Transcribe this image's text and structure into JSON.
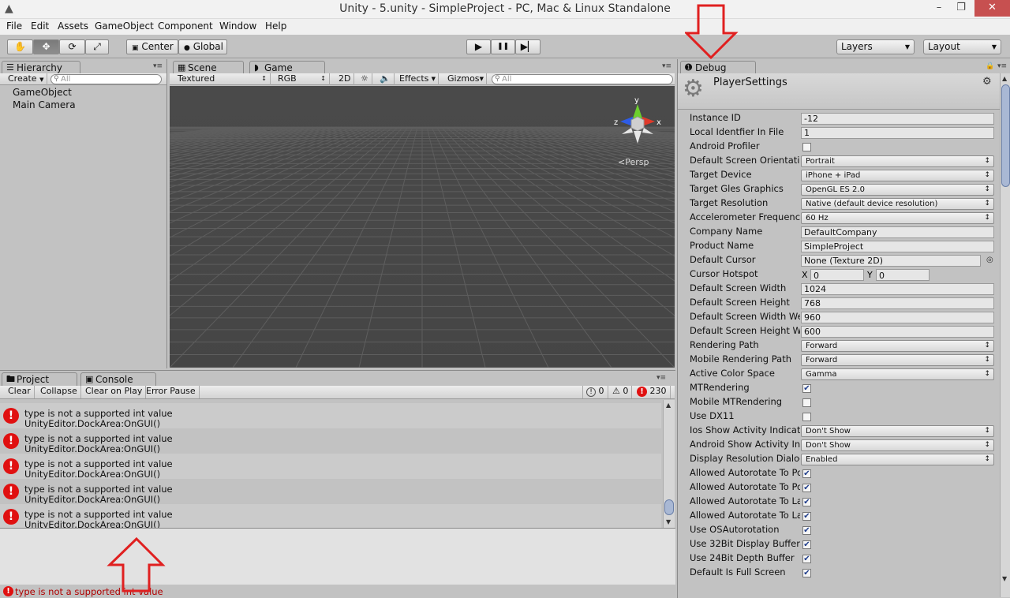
{
  "window": {
    "title": "Unity - 5.unity - SimpleProject - PC, Mac & Linux Standalone",
    "minimize": "–",
    "maximize": "❐",
    "close": "✕"
  },
  "menu": [
    "File",
    "Edit",
    "Assets",
    "GameObject",
    "Component",
    "Window",
    "Help"
  ],
  "toolbar": {
    "tools": [
      "hand-icon",
      "move-icon",
      "rotate-icon",
      "scale-icon"
    ],
    "center": "Center",
    "global": "Global",
    "play": "▶",
    "pause": "❚❚",
    "step": "▶▏",
    "layers": "Layers",
    "layout": "Layout"
  },
  "hierarchy": {
    "tab": "Hierarchy",
    "create": "Create",
    "search": "All",
    "items": [
      "GameObject",
      "Main Camera"
    ]
  },
  "scene": {
    "tab_scene": "Scene",
    "tab_game": "Game",
    "shading": "Textured",
    "render": "RGB",
    "mode2d": "2D",
    "effects": "Effects",
    "gizmos": "Gizmos",
    "search": "All",
    "persp": "Persp",
    "axis_x": "x",
    "axis_y": "y",
    "axis_z": "z"
  },
  "console": {
    "tab_project": "Project",
    "tab_console": "Console",
    "clear": "Clear",
    "collapse": "Collapse",
    "clear_on_play": "Clear on Play",
    "error_pause": "Error Pause",
    "count_info": "0",
    "count_warn": "0",
    "count_err": "230",
    "rows": [
      {
        "line1": "type is not a supported int value",
        "line2": "UnityEditor.DockArea:OnGUI()"
      },
      {
        "line1": "type is not a supported int value",
        "line2": "UnityEditor.DockArea:OnGUI()"
      },
      {
        "line1": "type is not a supported int value",
        "line2": "UnityEditor.DockArea:OnGUI()"
      },
      {
        "line1": "type is not a supported int value",
        "line2": "UnityEditor.DockArea:OnGUI()"
      },
      {
        "line1": "type is not a supported int value",
        "line2": "UnityEditor.DockArea:OnGUI()"
      }
    ]
  },
  "statusbar": {
    "message": "type is not a supported int value"
  },
  "inspector": {
    "tab": "Debug",
    "title": "PlayerSettings",
    "rows": [
      {
        "label": "Instance ID",
        "type": "field",
        "value": "-12"
      },
      {
        "label": "Local Identfier In File",
        "type": "field",
        "value": "1"
      },
      {
        "label": "Android Profiler",
        "type": "check",
        "value": ""
      },
      {
        "label": "Default Screen Orientation",
        "type": "dropdown",
        "value": "Portrait"
      },
      {
        "label": "Target Device",
        "type": "dropdown",
        "value": "iPhone + iPad"
      },
      {
        "label": "Target Gles Graphics",
        "type": "dropdown",
        "value": "OpenGL ES 2.0"
      },
      {
        "label": "Target Resolution",
        "type": "dropdown",
        "value": "Native (default device resolution)"
      },
      {
        "label": "Accelerometer Frequency",
        "type": "dropdown",
        "value": "60 Hz"
      },
      {
        "label": "Company Name",
        "type": "field",
        "value": "DefaultCompany"
      },
      {
        "label": "Product Name",
        "type": "field",
        "value": "SimpleProject"
      },
      {
        "label": "Default Cursor",
        "type": "object",
        "value": "None (Texture 2D)"
      },
      {
        "label": "Cursor Hotspot",
        "type": "xy",
        "x_label": "X",
        "x_value": "0",
        "y_label": "Y",
        "y_value": "0"
      },
      {
        "label": "Default Screen Width",
        "type": "field",
        "value": "1024"
      },
      {
        "label": "Default Screen Height",
        "type": "field",
        "value": "768"
      },
      {
        "label": "Default Screen Width Web",
        "type": "field",
        "value": "960"
      },
      {
        "label": "Default Screen Height Web",
        "type": "field",
        "value": "600"
      },
      {
        "label": "Rendering Path",
        "type": "dropdown",
        "value": "Forward"
      },
      {
        "label": "Mobile Rendering Path",
        "type": "dropdown",
        "value": "Forward"
      },
      {
        "label": "Active Color Space",
        "type": "dropdown",
        "value": "Gamma"
      },
      {
        "label": "MTRendering",
        "type": "check",
        "value": "✔"
      },
      {
        "label": "Mobile MTRendering",
        "type": "check",
        "value": ""
      },
      {
        "label": "Use DX11",
        "type": "check",
        "value": ""
      },
      {
        "label": "Ios Show Activity Indicator",
        "type": "dropdown",
        "value": "Don't Show"
      },
      {
        "label": "Android Show Activity Indicator",
        "type": "dropdown",
        "value": "Don't Show"
      },
      {
        "label": "Display Resolution Dialog",
        "type": "dropdown",
        "value": "Enabled"
      },
      {
        "label": "Allowed Autorotate To Portrait",
        "type": "check",
        "value": "✔"
      },
      {
        "label": "Allowed Autorotate To Portrait Upside Down",
        "type": "check",
        "value": "✔"
      },
      {
        "label": "Allowed Autorotate To Landscape Right",
        "type": "check",
        "value": "✔"
      },
      {
        "label": "Allowed Autorotate To Landscape Left",
        "type": "check",
        "value": "✔"
      },
      {
        "label": "Use OSAutorotation",
        "type": "check",
        "value": "✔"
      },
      {
        "label": "Use 32Bit Display Buffer",
        "type": "check",
        "value": "✔"
      },
      {
        "label": "Use 24Bit Depth Buffer",
        "type": "check",
        "value": "✔"
      },
      {
        "label": "Default Is Full Screen",
        "type": "check",
        "value": "✔"
      }
    ]
  },
  "colors": {
    "error": "#e01010",
    "annotation": "#e02020",
    "scene_bg": "#474747"
  }
}
